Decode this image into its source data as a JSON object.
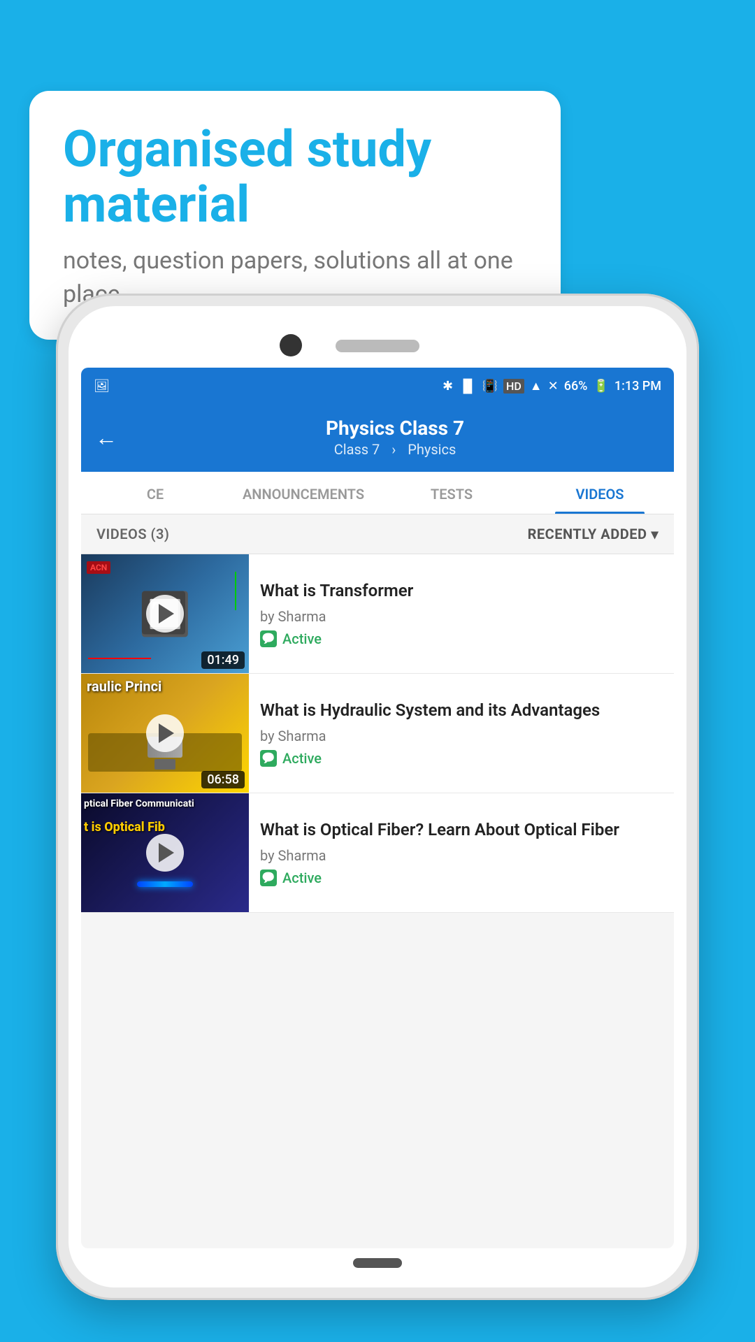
{
  "background_color": "#1ab0e8",
  "speech_bubble": {
    "heading": "Organised study material",
    "subtext": "notes, question papers, solutions all at one place"
  },
  "status_bar": {
    "battery": "66%",
    "time": "1:13 PM",
    "signal_icons": "🔵 📳 HD ▲ ✕ ✕"
  },
  "app_bar": {
    "title": "Physics Class 7",
    "subtitle_class": "Class 7",
    "subtitle_subject": "Physics",
    "back_icon": "←"
  },
  "tabs": [
    {
      "label": "CE",
      "active": false
    },
    {
      "label": "ANNOUNCEMENTS",
      "active": false
    },
    {
      "label": "TESTS",
      "active": false
    },
    {
      "label": "VIDEOS",
      "active": true
    }
  ],
  "list_header": {
    "count_label": "VIDEOS (3)",
    "sort_label": "RECENTLY ADDED",
    "sort_icon": "▾"
  },
  "videos": [
    {
      "title": "What is  Transformer",
      "author": "by Sharma",
      "status": "Active",
      "duration": "01:49",
      "thumb_type": "transformer",
      "thumb_text": ""
    },
    {
      "title": "What is Hydraulic System and its Advantages",
      "author": "by Sharma",
      "status": "Active",
      "duration": "06:58",
      "thumb_type": "hydraulic",
      "thumb_text": "raulic Princi"
    },
    {
      "title": "What is Optical Fiber? Learn About Optical Fiber",
      "author": "by Sharma",
      "status": "Active",
      "duration": "",
      "thumb_type": "optical",
      "thumb_text": "ptical Fiber Communicati\nt is Optical Fib"
    }
  ]
}
